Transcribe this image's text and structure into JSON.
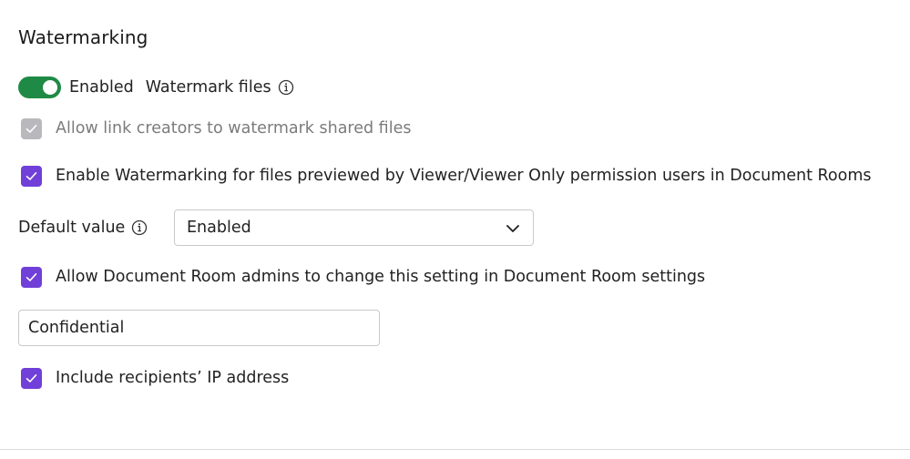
{
  "section": {
    "title": "Watermarking"
  },
  "toggle": {
    "state_label": "Enabled",
    "label": "Watermark files",
    "on": true,
    "color": "#1f8a45",
    "info_icon": "info-icon"
  },
  "options": {
    "allow_link_creators": {
      "label": "Allow link creators to watermark shared files",
      "checked": true,
      "disabled": true
    },
    "enable_viewer_watermarking": {
      "label": "Enable Watermarking for files previewed by Viewer/Viewer Only permission users in Document Rooms",
      "checked": true
    },
    "allow_admins_change": {
      "label": "Allow Document Room admins to change this setting in Document Room settings",
      "checked": true
    },
    "include_ip": {
      "label": "Include recipients’ IP address",
      "checked": true
    }
  },
  "default_value": {
    "label": "Default value",
    "selected": "Enabled",
    "info_icon": "info-icon"
  },
  "watermark_text": {
    "value": "Confidential"
  },
  "colors": {
    "accent_checkbox": "#7040d8",
    "disabled_checkbox": "#b9b9bd",
    "toggle_on": "#1f8a45"
  }
}
